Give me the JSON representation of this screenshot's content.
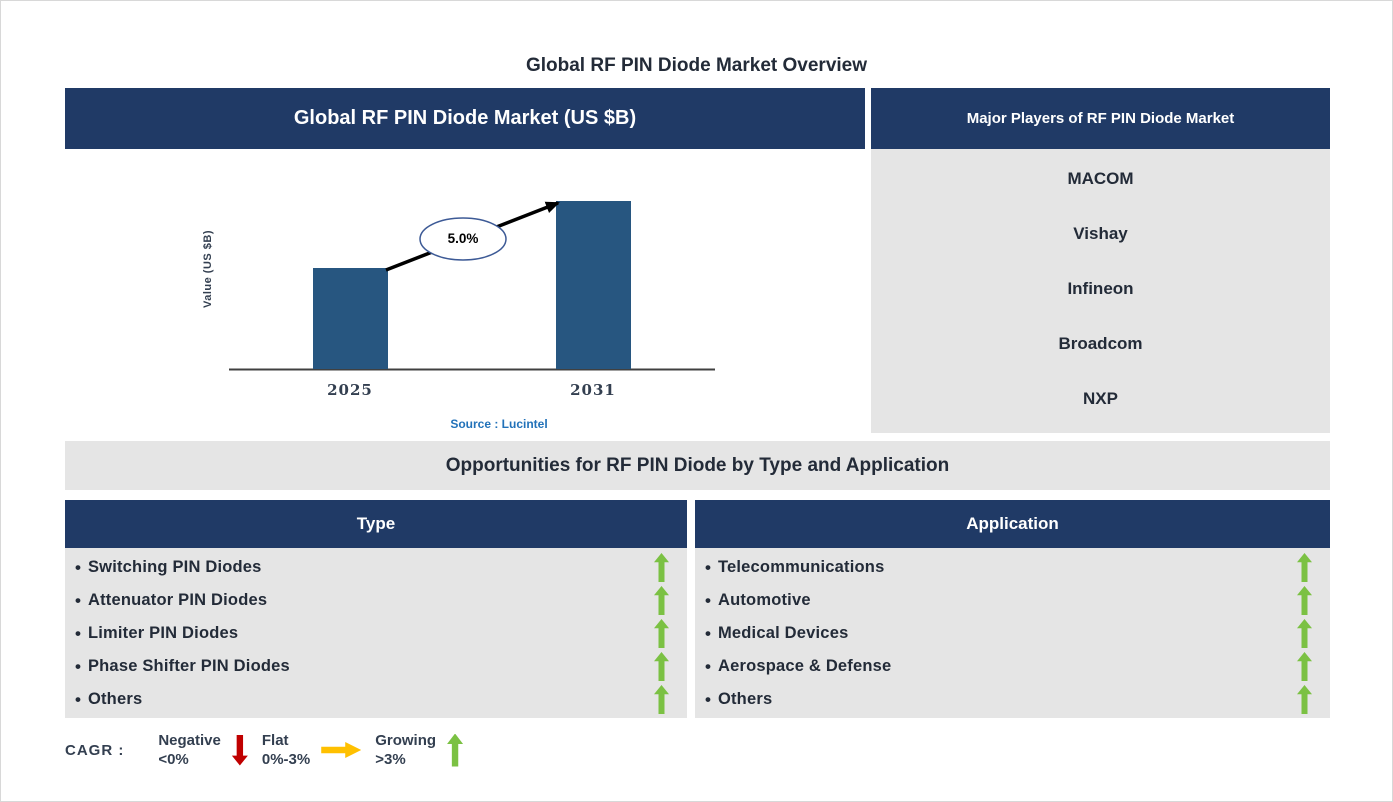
{
  "page": {
    "title": "Global RF PIN Diode Market Overview"
  },
  "theme": {
    "navy": "#203A66",
    "bar-blue": "#275680",
    "panel-gray": "#E5E5E5",
    "green": "#7BC143",
    "red": "#C00000",
    "amber": "#FFC000",
    "text-dark": "#232B38",
    "muted-navy": "#333F50",
    "source-blue": "#2272B9"
  },
  "chart_panel": {
    "header": "Global RF PIN Diode Market (US $B)"
  },
  "chart_data": {
    "type": "bar",
    "title": "Global RF PIN Diode Market (US $B)",
    "categories": [
      "2025",
      "2031"
    ],
    "relative_values": [
      0.6,
      1.0
    ],
    "value_note": "y-axis unlabeled; bars drawn proportionally, 2031 bar ~1.66x the 2025 bar",
    "ylabel": "Value (US $B)",
    "xlabel": "",
    "cagr_label": "5.0%",
    "source": "Source : Lucintel",
    "grid": false,
    "legend_position": "none"
  },
  "players": {
    "header": "Major Players of RF PIN Diode Market",
    "companies": [
      "MACOM",
      "Vishay",
      "Infineon",
      "Broadcom",
      "NXP"
    ]
  },
  "opportunities": {
    "banner": "Opportunities for RF PIN Diode by Type and Application",
    "bullet": "•",
    "type": {
      "header": "Type",
      "items": [
        "Switching PIN Diodes",
        "Attenuator PIN Diodes",
        "Limiter PIN Diodes",
        "Phase Shifter PIN Diodes",
        "Others"
      ],
      "trend_per_item": [
        "growing",
        "growing",
        "growing",
        "growing",
        "growing"
      ]
    },
    "application": {
      "header": "Application",
      "items": [
        "Telecommunications",
        "Automotive",
        "Medical Devices",
        "Aerospace & Defense",
        "Others"
      ],
      "trend_per_item": [
        "growing",
        "growing",
        "growing",
        "growing",
        "growing"
      ]
    }
  },
  "legend": {
    "label": "CAGR :",
    "items": [
      {
        "name": "Negative",
        "range": "<0%",
        "direction": "down",
        "color": "#C00000"
      },
      {
        "name": "Flat",
        "range": "0%-3%",
        "direction": "right",
        "color": "#FFC000"
      },
      {
        "name": "Growing",
        "range": ">3%",
        "direction": "up",
        "color": "#7BC143"
      }
    ]
  }
}
